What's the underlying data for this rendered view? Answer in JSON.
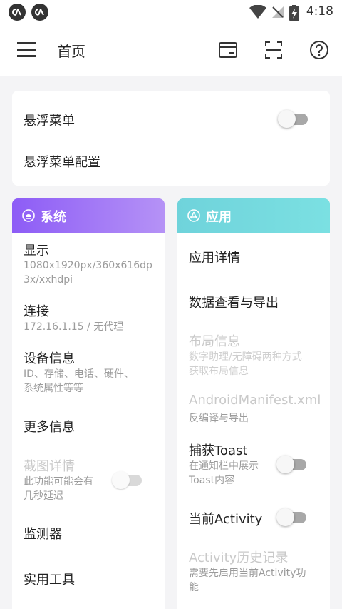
{
  "status_bar": {
    "time": "4:18",
    "icons": [
      "app-badge-icon",
      "app-badge-icon",
      "wifi-icon",
      "no-signal-icon",
      "battery-charging-icon"
    ]
  },
  "app_bar": {
    "title": "首页",
    "icons": [
      "menu-icon",
      "card-icon",
      "scan-icon",
      "help-icon"
    ]
  },
  "top_card": {
    "floating_menu_label": "悬浮菜单",
    "floating_menu_on": false,
    "floating_menu_config_label": "悬浮菜单配置"
  },
  "system": {
    "header": "系统",
    "header_icon": "android-icon",
    "items": [
      {
        "label": "显示",
        "sub": "1080x1920px/360x616dp\n3x/xxhdpi"
      },
      {
        "label": "连接",
        "sub": "172.16.1.15 / 无代理"
      },
      {
        "label": "设备信息",
        "sub": "ID、存储、电话、硬件、\n系统属性等等"
      },
      {
        "label": "更多信息"
      },
      {
        "label": "截图详情",
        "sub": "此功能可能会有\n几秒延迟",
        "disabled": true,
        "toggle_on": false
      },
      {
        "label": "监测器"
      },
      {
        "label": "实用工具"
      }
    ]
  },
  "apps": {
    "header": "应用",
    "header_icon": "app-store-icon",
    "items": [
      {
        "label": "应用详情"
      },
      {
        "label": "数据查看与导出"
      },
      {
        "label": "布局信息",
        "sub": "数字助理/无障碍两种方式\n获取布局信息",
        "disabled": true
      },
      {
        "label": "AndroidManifest.xml",
        "sub": "反编译与导出",
        "disabled": true
      },
      {
        "label": "捕获Toast",
        "sub": "在通知栏中展示\nToast内容",
        "toggle_on": false
      },
      {
        "label": "当前Activity",
        "toggle_on": false
      },
      {
        "label": "Activity历史记录",
        "sub": "需要先启用当前Activity功\n能",
        "disabled": true
      }
    ]
  },
  "colors": {
    "system_gradient_start": "#8d5cf6",
    "system_gradient_end": "#b592f6",
    "apps_gradient_start": "#6fd3db",
    "apps_gradient_end": "#7be0e2",
    "background": "#f4f4f6"
  }
}
